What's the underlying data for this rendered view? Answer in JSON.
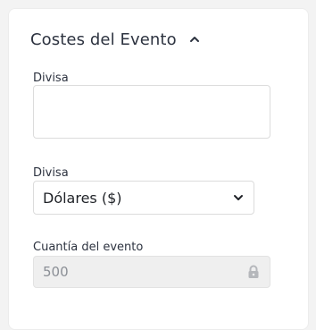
{
  "section": {
    "title": "Costes del Evento"
  },
  "fields": {
    "currency_text": {
      "label": "Divisa",
      "value": "",
      "placeholder": ""
    },
    "currency_select": {
      "label": "Divisa",
      "selected": "Dólares ($)"
    },
    "event_amount": {
      "label": "Cuantía del evento",
      "value": "500"
    }
  },
  "colors": {
    "background": "#f3f3f3",
    "card": "#ffffff",
    "border": "#dcdcdc",
    "disabled_bg": "#efefef",
    "disabled_text": "#8b8f96",
    "icon": "#b5b7bb"
  },
  "icons": {
    "collapse": "chevron-up-icon",
    "dropdown": "chevron-down-icon",
    "locked": "lock-icon"
  }
}
